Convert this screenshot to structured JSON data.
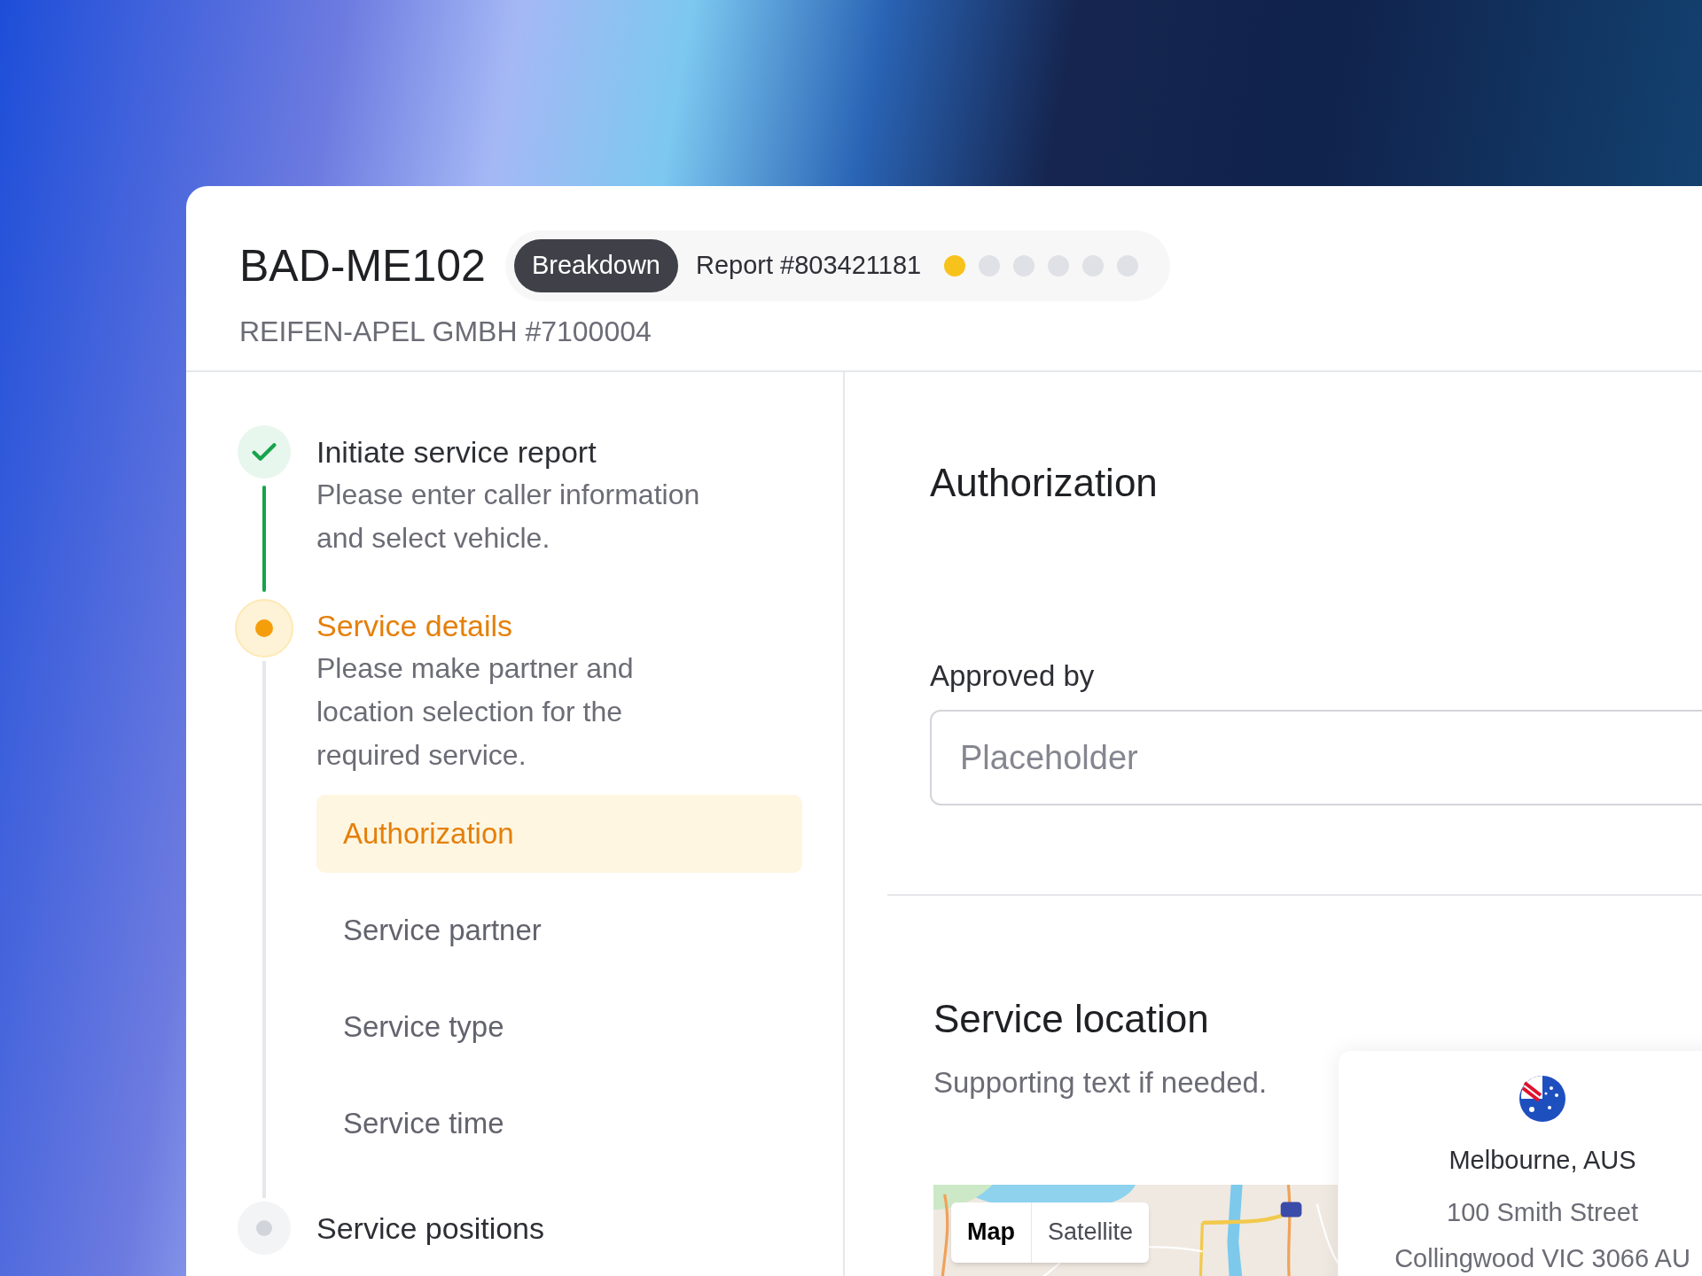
{
  "header": {
    "title": "BAD-ME102",
    "badge": "Breakdown",
    "report": "Report #803421181",
    "progress_dots": [
      {
        "active": true
      },
      {
        "active": false
      },
      {
        "active": false
      },
      {
        "active": false
      },
      {
        "active": false
      },
      {
        "active": false
      }
    ],
    "subtitle": "REIFEN-APEL GMBH #7100004"
  },
  "steps": [
    {
      "kind": "completed",
      "title": "Initiate service report",
      "description": "Please enter caller information and select vehicle."
    },
    {
      "kind": "current",
      "title": "Service details",
      "description": "Please make partner and location selection for the required service.",
      "substeps": [
        {
          "label": "Authorization",
          "selected": true
        },
        {
          "label": "Service partner",
          "selected": false
        },
        {
          "label": "Service type",
          "selected": false
        },
        {
          "label": "Service time",
          "selected": false
        }
      ]
    },
    {
      "kind": "upcoming",
      "title": "Service positions"
    }
  ],
  "authorization": {
    "heading": "Authorization",
    "field_label": "Approved by",
    "placeholder": "Placeholder"
  },
  "service_location": {
    "heading": "Service location",
    "supporting_text": "Supporting text if needed.",
    "map_types": [
      {
        "label": "Map",
        "selected": true
      },
      {
        "label": "Satellite",
        "selected": false
      }
    ],
    "location_card": {
      "city": "Melbourne, AUS",
      "street": "100 Smith Street",
      "locality": "Collingwood VIC 3066 AU"
    }
  }
}
